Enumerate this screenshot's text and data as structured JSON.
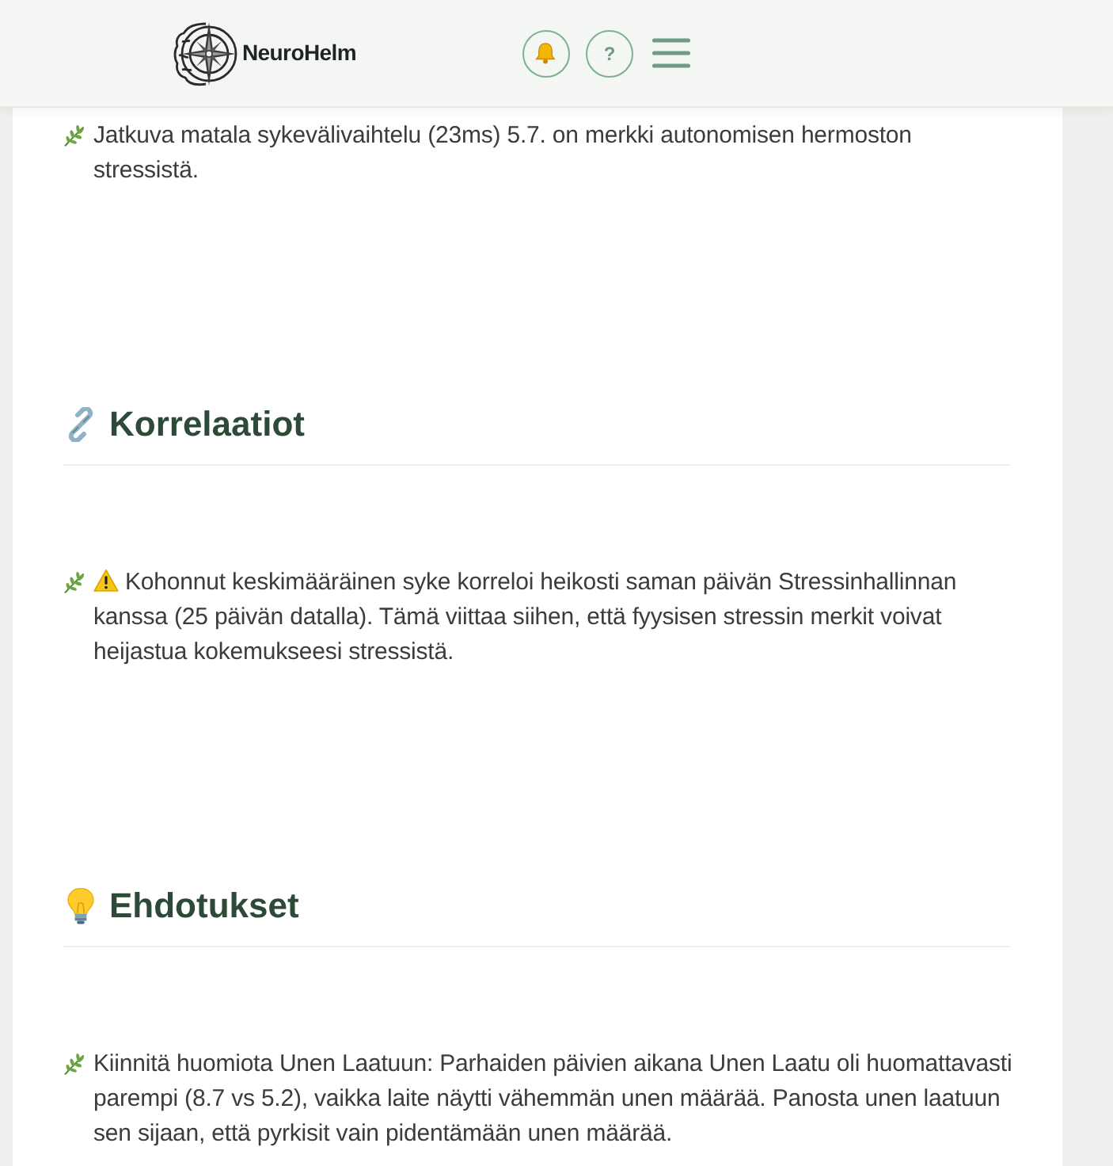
{
  "header": {
    "brand": "NeuroHelm",
    "buttons": [
      {
        "kind": "bell"
      },
      {
        "kind": "help",
        "label": "?"
      },
      {
        "kind": "menu"
      }
    ]
  },
  "sections": [
    {
      "items": [
        {
          "kind": "note",
          "text": "Jatkuva matala sykevälivaihtelu (23ms) 5.7. on merkki autonomisen hermoston stressistä."
        }
      ]
    },
    {
      "kind": "link",
      "title": "Korrelaatiot",
      "items": [
        {
          "kind": "warning",
          "text": "Kohonnut keskimääräinen syke korreloi heikosti saman päivän Stressinhallinnan kanssa (25 päivän datalla). Tämä viittaa siihen, että fyysisen stressin merkit voivat heijastua kokemukseesi stressistä."
        }
      ]
    },
    {
      "kind": "bulb",
      "title": "Ehdotukset",
      "items": [
        {
          "kind": "note",
          "text": "Kiinnitä huomiota Unen Laatuun: Parhaiden päivien aikana Unen Laatu oli huomattavasti parempi (8.7 vs 5.2), vaikka laite näytti vähemmän unen määrää. Panosta unen laatuun sen sijaan, että pyrkisit vain pidentämään unen määrää."
        }
      ]
    }
  ]
}
